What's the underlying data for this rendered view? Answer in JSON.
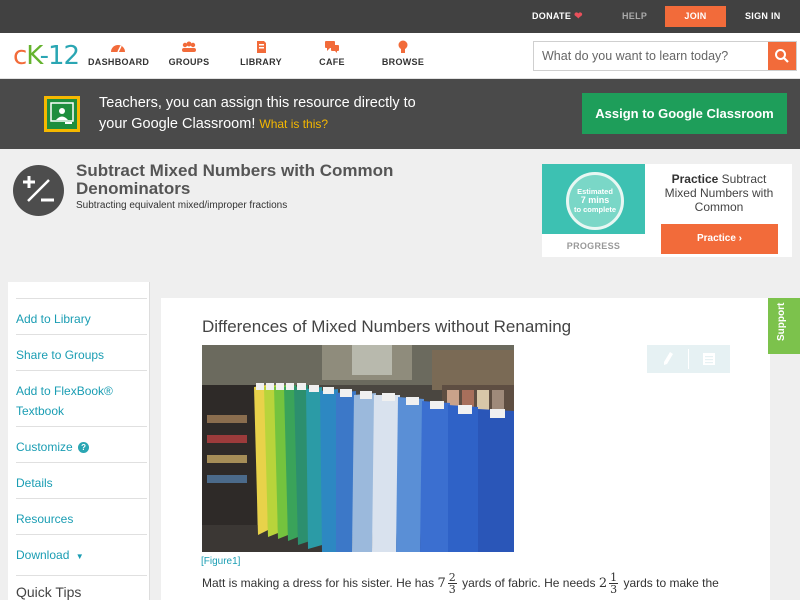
{
  "topbar": {
    "donate": "DONATE",
    "help": "HELP",
    "join": "JOIN",
    "signin": "SIGN IN"
  },
  "logo": {
    "c": "c",
    "k": "K",
    "n": "-12"
  },
  "nav": [
    {
      "label": "DASHBOARD",
      "icon": "dashboard-icon"
    },
    {
      "label": "GROUPS",
      "icon": "groups-icon"
    },
    {
      "label": "LIBRARY",
      "icon": "library-icon"
    },
    {
      "label": "CAFE",
      "icon": "cafe-icon"
    },
    {
      "label": "BROWSE",
      "icon": "browse-icon"
    }
  ],
  "search": {
    "placeholder": "What do you want to learn today?"
  },
  "classroom": {
    "line1": "Teachers, you can assign this resource directly to",
    "line2": "your Google Classroom!",
    "what": "What is this?",
    "button": "Assign to Google Classroom"
  },
  "concept": {
    "title": "Subtract Mixed Numbers with Common Denominators",
    "subtitle": "Subtracting equivalent mixed/improper fractions"
  },
  "practice_card": {
    "est_line1": "Estimated",
    "est_line2": "7 mins",
    "est_line3": "to complete",
    "progress": "PROGRESS",
    "bold": "Practice",
    "text_rest1": "Subtract",
    "text_rest2": "Mixed Numbers with",
    "text_rest3": "Common",
    "button": "Practice"
  },
  "sidebar": {
    "items": [
      "Add to Library",
      "Share to Groups",
      "Add to FlexBook®",
      "Textbook",
      "Customize",
      "Details",
      "Resources",
      "Download",
      "Quick Tips"
    ],
    "customize_badge": "?",
    "download_arrow": "▼"
  },
  "content": {
    "title": "Differences of Mixed Numbers without Renaming",
    "figure": "[Figure1]",
    "para_a": "Matt is making a dress for his sister. He has",
    "whole1": "7",
    "num1": "2",
    "den1": "3",
    "para_b": "yards of fabric. He needs",
    "whole2": "2",
    "num2": "1",
    "den2": "3",
    "para_c": "yards to make the"
  },
  "support": "Support",
  "colors": {
    "accent": "#f26b3a",
    "teal": "#1a9db3",
    "google_green": "#1e9e5a",
    "support_green": "#7cc24c"
  }
}
